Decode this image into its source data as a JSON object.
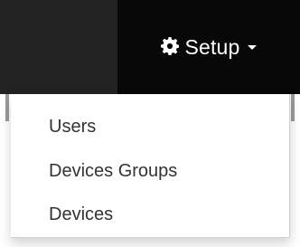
{
  "navbar": {
    "setup_menu": {
      "icon": "gear-icon",
      "label": "Setup",
      "caret_icon": "caret-down-icon",
      "background": "#080808",
      "text_color": "#ffffff",
      "items": [
        {
          "label": "Users"
        },
        {
          "label": "Devices Groups"
        },
        {
          "label": "Devices"
        }
      ]
    }
  }
}
